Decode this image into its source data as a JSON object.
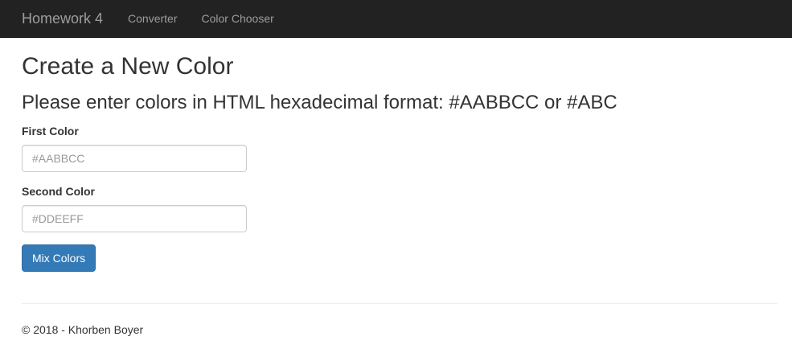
{
  "navbar": {
    "brand": "Homework 4",
    "links": [
      {
        "label": "Converter"
      },
      {
        "label": "Color Chooser"
      }
    ]
  },
  "main": {
    "title": "Create a New Color",
    "subtitle": "Please enter colors in HTML hexadecimal format: #AABBCC or #ABC",
    "first_color": {
      "label": "First Color",
      "value": "",
      "placeholder": "#AABBCC"
    },
    "second_color": {
      "label": "Second Color",
      "value": "",
      "placeholder": "#DDEEFF"
    },
    "submit_label": "Mix Colors"
  },
  "footer": {
    "text": "© 2018 - Khorben Boyer"
  },
  "colors": {
    "navbar_bg": "#222222",
    "primary": "#337ab7"
  }
}
